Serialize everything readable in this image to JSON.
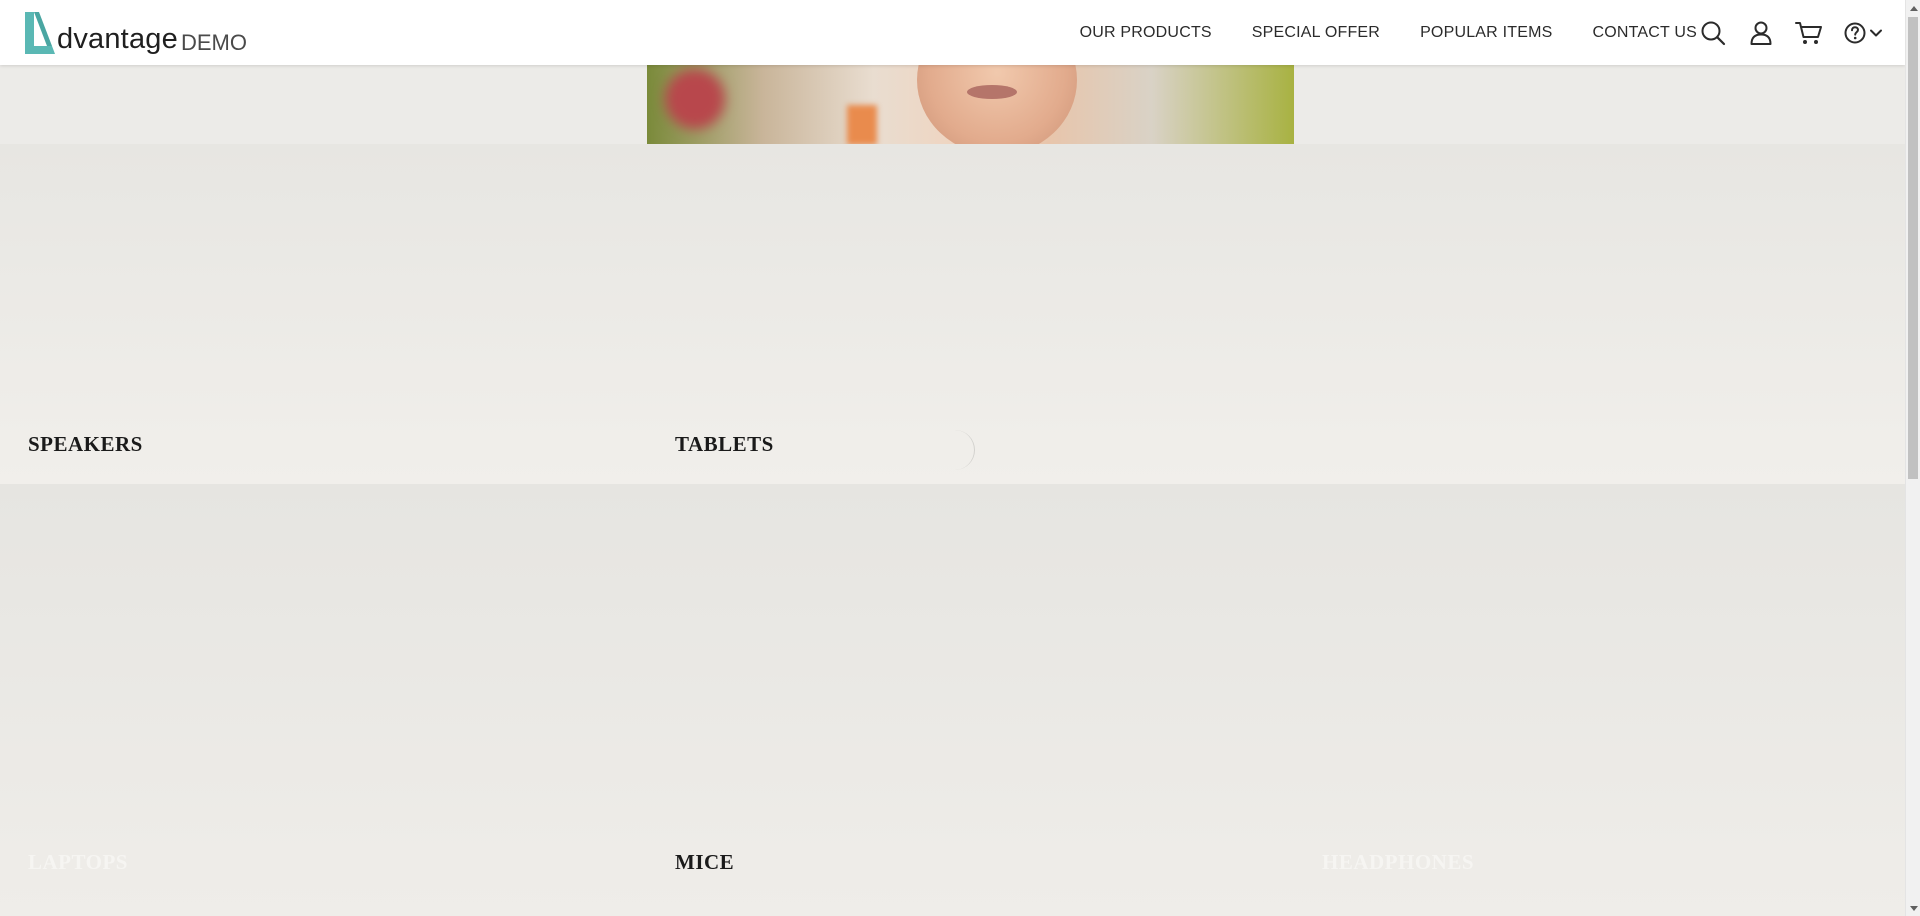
{
  "brand": {
    "logo_letter": "A",
    "name": "dvantage",
    "suffix": "DEMO",
    "accent_color": "#5ab8b4"
  },
  "nav": {
    "items": [
      {
        "label": "OUR PRODUCTS"
      },
      {
        "label": "SPECIAL OFFER"
      },
      {
        "label": "POPULAR ITEMS"
      },
      {
        "label": "CONTACT US"
      }
    ]
  },
  "header_icons": {
    "search": "search-icon",
    "user": "user-icon",
    "cart": "cart-icon",
    "help": "help-icon",
    "help_menu": "chevron-down-icon"
  },
  "categories": {
    "row1": [
      {
        "label": "SPEAKERS"
      },
      {
        "label": "TABLETS"
      }
    ],
    "row2": [
      {
        "label": "LAPTOPS"
      },
      {
        "label": "MICE"
      },
      {
        "label": "HEADPHONES"
      }
    ]
  }
}
